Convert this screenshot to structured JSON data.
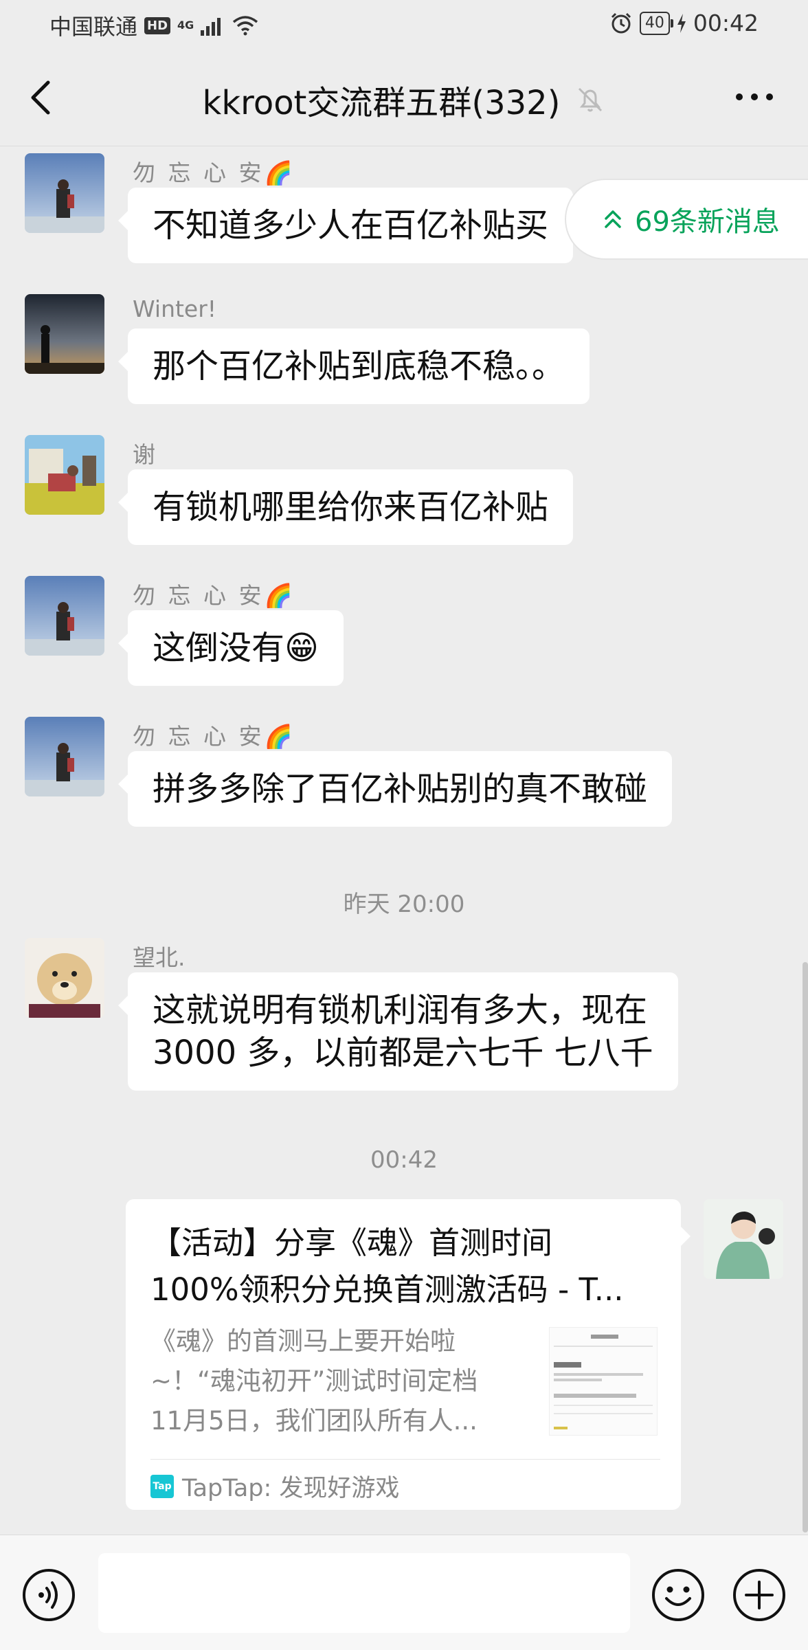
{
  "status_bar": {
    "carrier": "中国联通",
    "hd": "HD",
    "network": "4G",
    "battery": "40",
    "time": "00:42"
  },
  "header": {
    "title": "kkroot交流群五群(332)"
  },
  "new_messages": "69条新消息",
  "messages": [
    {
      "sender": "勿 忘 心 安🌈",
      "text": "不知道多少人在百亿补贴买"
    },
    {
      "sender": "Winter!",
      "text": "那个百亿补贴到底稳不稳。。"
    },
    {
      "sender": "谢",
      "text": "有锁机哪里给你来百亿补贴"
    },
    {
      "sender": "勿 忘 心 安🌈",
      "text": "这倒没有😁"
    },
    {
      "sender": "勿 忘 心 安🌈",
      "text": "拼多多除了百亿补贴别的真不敢碰"
    },
    {
      "sender": "望北.",
      "text_line1": "这就说明有锁机利润有多大，现在",
      "text_line2": "3000 多，以前都是六七千 七八千"
    }
  ],
  "timestamps": [
    "昨天 20:00",
    "00:42"
  ],
  "link_card": {
    "title_line1": "【活动】分享《魂》首测时间",
    "title_line2": "100%领积分兑换首测激活码 - T...",
    "desc_line1": "《魂》的首测马上要开始啦",
    "desc_line2": "~！“魂沌初开”测试时间定档",
    "desc_line3": "11月5日，我们团队所有人...",
    "source": "TapTap: 发现好游戏",
    "source_logo": "Tap"
  },
  "input": {
    "placeholder": ""
  },
  "colors": {
    "background": "#ededed",
    "bubble": "#ffffff",
    "accent_green": "#07a35a",
    "taptap": "#17c6d4"
  }
}
